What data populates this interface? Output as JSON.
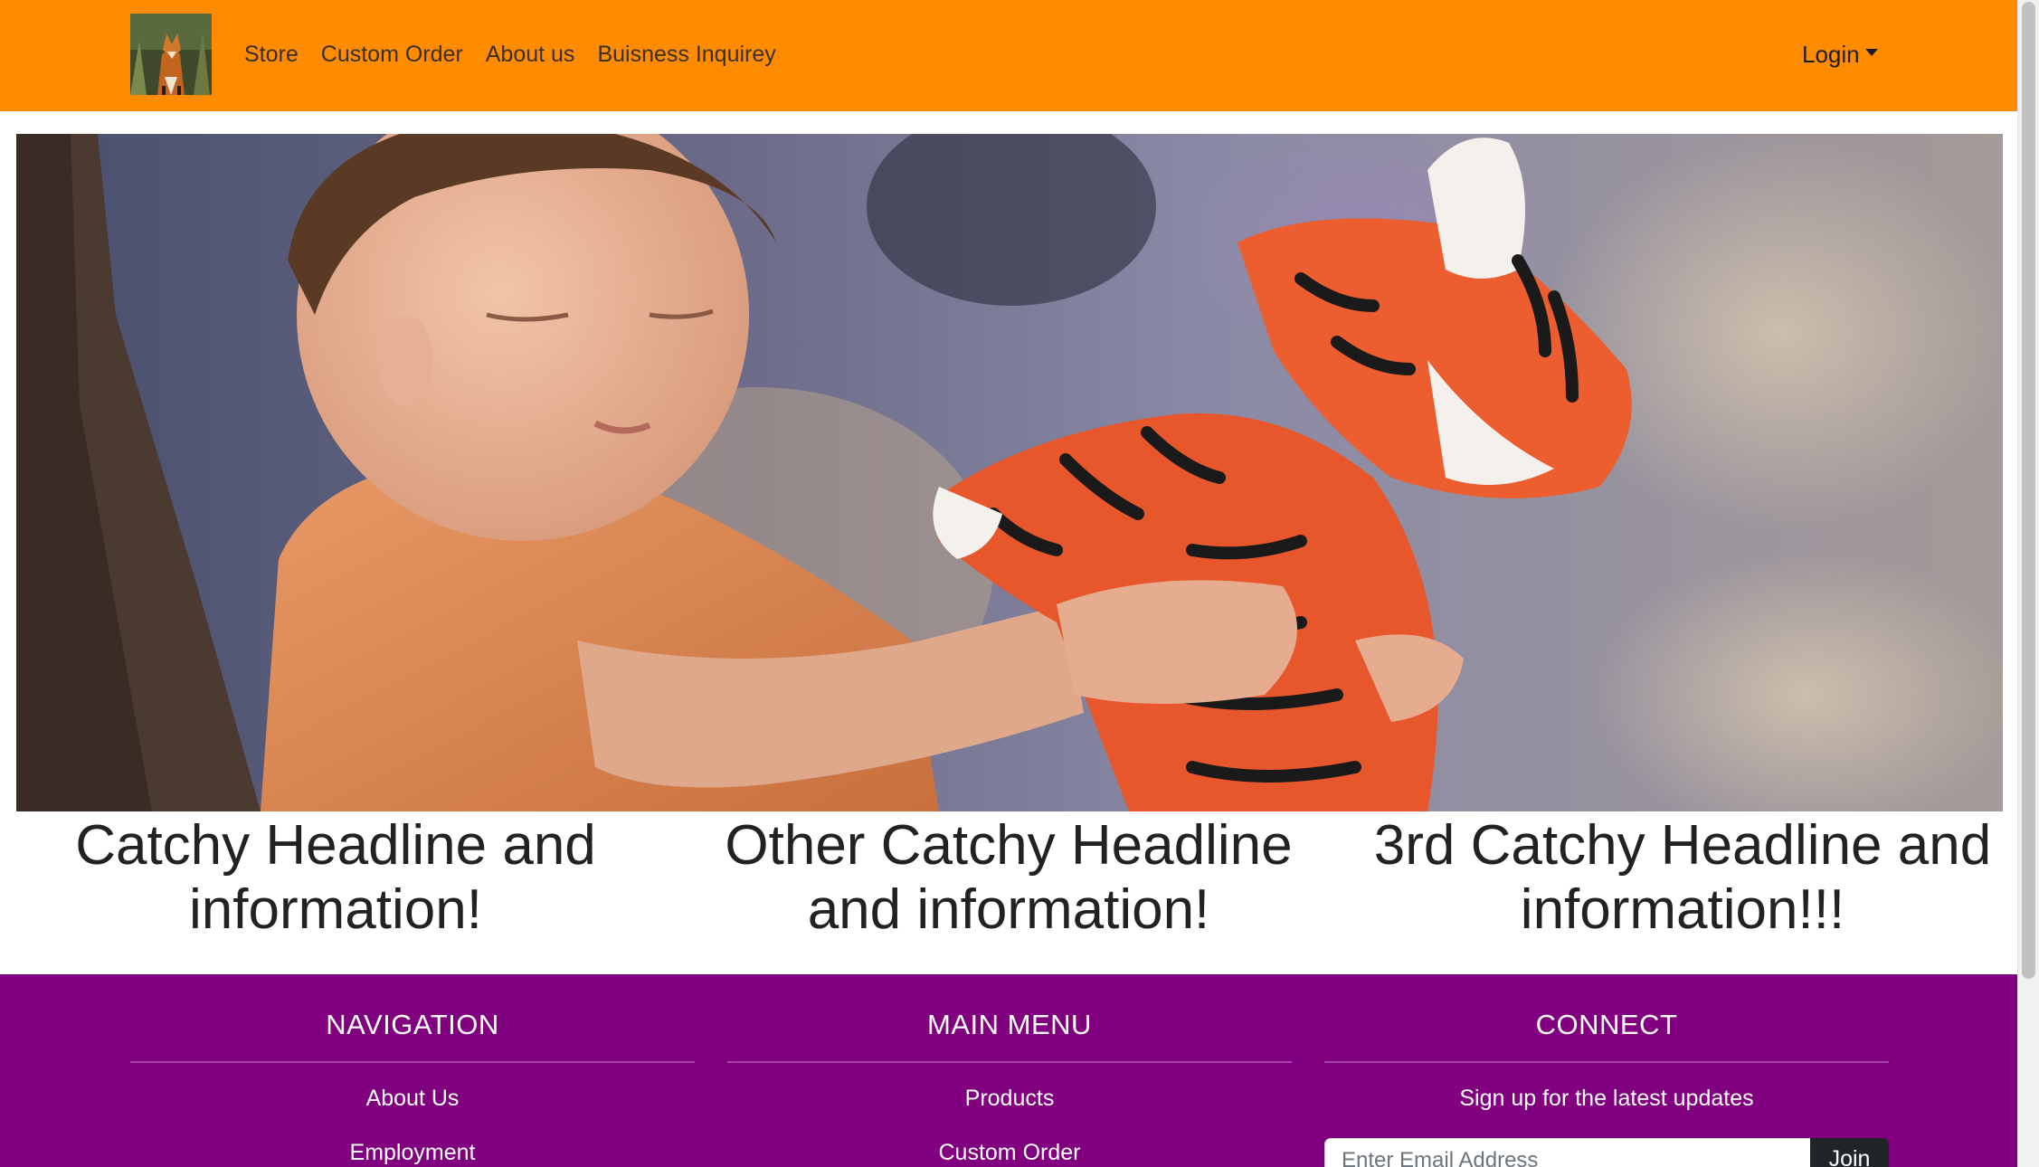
{
  "navbar": {
    "logo_alt": "fox-logo",
    "links": [
      "Store",
      "Custom Order",
      "About us",
      "Buisness Inquirey"
    ],
    "login_label": "Login",
    "background_color": "#ff8c00"
  },
  "hero": {
    "image_subject": "child holding orange tiger toy"
  },
  "headlines": [
    {
      "line1": "Catchy Headline and",
      "line2": "information!"
    },
    {
      "line1": "Other Catchy Headline",
      "line2": "and information!"
    },
    {
      "line1": "3rd Catchy Headline and",
      "line2": "information!!!"
    }
  ],
  "footer": {
    "background_color": "#800080",
    "navigation": {
      "title": "NAVIGATION",
      "items": [
        "About Us",
        "Employment"
      ]
    },
    "main_menu": {
      "title": "MAIN MENU",
      "items": [
        "Products",
        "Custom Order"
      ]
    },
    "connect": {
      "title": "CONNECT",
      "text": "Sign up for the latest updates",
      "email_placeholder": "Enter Email Address",
      "join_label": "Join"
    }
  }
}
